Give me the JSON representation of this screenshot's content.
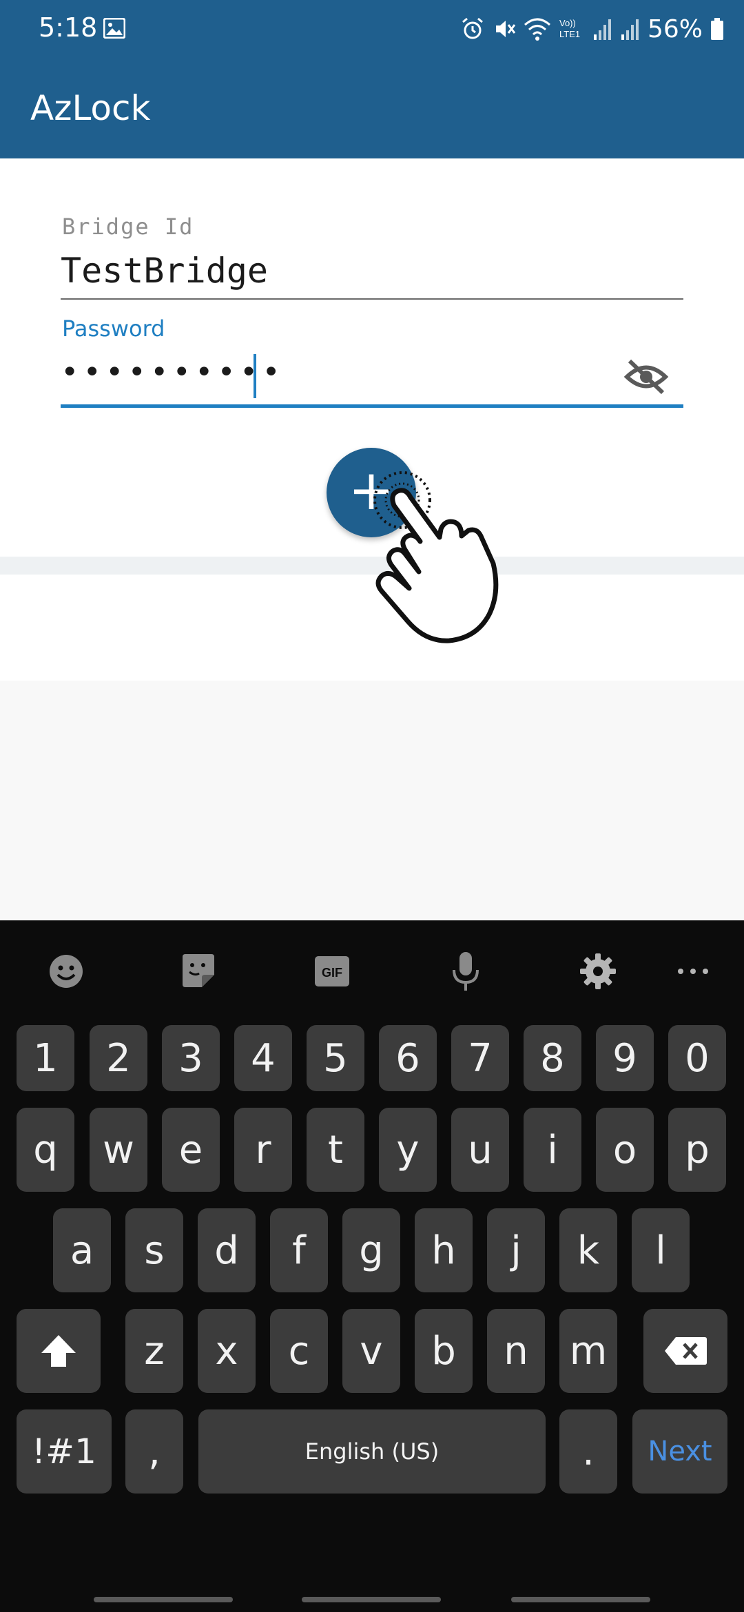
{
  "status_bar": {
    "time": "5:18",
    "battery": "56%",
    "icons": [
      "gallery-icon",
      "alarm-icon",
      "mute-icon",
      "wifi-icon",
      "volte-icon",
      "signal-icon",
      "signal-icon",
      "battery-icon"
    ]
  },
  "app_bar": {
    "title": "AzLock"
  },
  "form": {
    "bridge_label": "Bridge Id",
    "bridge_value": "TestBridge",
    "password_label": "Password",
    "password_masked": "••••••••••",
    "visibility_icon": "eye-off-icon"
  },
  "fab": {
    "label": "+",
    "icon": "plus-icon"
  },
  "keyboard": {
    "toolbar_icons": [
      "emoji-icon",
      "sticker-icon",
      "gif-icon",
      "mic-icon",
      "gear-icon",
      "more-icon"
    ],
    "gif_label": "GIF",
    "row_numbers": [
      "1",
      "2",
      "3",
      "4",
      "5",
      "6",
      "7",
      "8",
      "9",
      "0"
    ],
    "row_1": [
      "q",
      "w",
      "e",
      "r",
      "t",
      "y",
      "u",
      "i",
      "o",
      "p"
    ],
    "row_2": [
      "a",
      "s",
      "d",
      "f",
      "g",
      "h",
      "j",
      "k",
      "l"
    ],
    "row_3": [
      "z",
      "x",
      "c",
      "v",
      "b",
      "n",
      "m"
    ],
    "symbols_label": "!#1",
    "comma_label": ",",
    "space_label": "English (US)",
    "period_label": ".",
    "next_label": "Next"
  },
  "colors": {
    "primary": "#1f5f8e",
    "accent": "#1f7fc2",
    "keyboard_bg": "#0c0c0c",
    "key_bg": "#3c3c3c",
    "next_key_text": "#4a90e2"
  }
}
